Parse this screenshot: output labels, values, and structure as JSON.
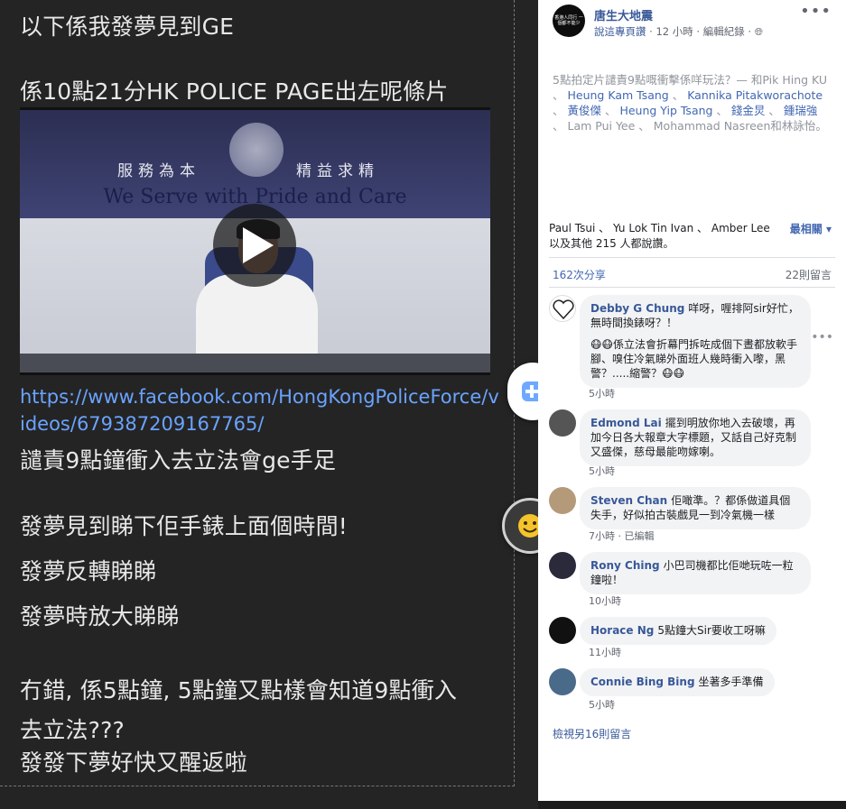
{
  "post_image": {
    "lines": [
      "以下係我發夢見到GE",
      "係10點21分HK POLICE PAGE出左呢條片",
      "譴責9點鐘衝入去立法會ge手足",
      "發夢見到睇下佢手錶上面個時間!",
      "發夢反轉睇睇",
      "發夢時放大睇睇",
      "冇錯, 係5點鐘, 5點鐘又點樣會知道9點衝入",
      "去立法???",
      "發發下夢好快又醒返啦"
    ],
    "link_line1": "https://www.facebook.com/HongKongPoliceForce/v",
    "link_line2": "ideos/679387209167765/",
    "video": {
      "motto_left": "服務為本",
      "motto_right": "精益求精",
      "slogan": "We Serve with Pride and Care"
    }
  },
  "page": {
    "avatar_text": "香港人同行 一個都不能少",
    "name": "唐生大地震",
    "meta_prefix": "說這專頁讚",
    "meta_time": "12 小時",
    "meta_edit": "編輯紀錄",
    "more": "•••"
  },
  "caption": {
    "text": "5點拍定片譴責9點嘅衝擊係咩玩法？— 和Pik Hing KU 、",
    "tags": [
      "Heung Kam Tsang",
      "Kannika Pitakworachote",
      "黃俊傑",
      "Heung Yip Tsang"
    ],
    "tags2": [
      "錢金炅",
      "鍾瑞強"
    ],
    "gray_tags": [
      "Lam Pui Yee",
      "Mohammad Nasreen"
    ],
    "tail": "和林詠怡。"
  },
  "reactions": {
    "names": "Paul Tsui 、 Yu Lok Tin Ivan 、 Amber Lee",
    "others": "以及其他 215 人都說讚。",
    "sort": "最相關"
  },
  "stats": {
    "shares": "162次分享",
    "comments": "22則留言"
  },
  "comments": [
    {
      "author": "Debby G Chung",
      "text": "咩呀，喱排阿sir好忙，無時間換錶呀？！",
      "text2": "😷😷係立法會折幕門拆咗成個下晝都放軟手腳、嗅住冷氣睇外面班人幾時衝入嚟，黑警？.....縮警？😷😷",
      "time": "5小時"
    },
    {
      "author": "Edmond Lai",
      "text": "擺到明放你地入去破壞，再加今日各大報章大字標題，又話自己好克制又盛傑，慈母最能吻嫁喇。",
      "time": "5小時"
    },
    {
      "author": "Steven Chan",
      "text": "佢噉準。？都係做道具個失手，好似拍古裝戲見一到冷氣機一樣",
      "time": "7小時 · 已編輯"
    },
    {
      "author": "Rony Ching",
      "text": "小巴司機都比佢哋玩咗一粒鐘啦！",
      "time": "10小時"
    },
    {
      "author": "Horace Ng",
      "text": "5點鐘大Sir要收工呀嘛",
      "time": "11小時"
    },
    {
      "author": "Connie Bing Bing",
      "text": "坐著多手準備",
      "time": "5小時"
    }
  ],
  "view_more": "檢視另16則留言",
  "colors": {
    "fb_blue": "#385898",
    "link_blue": "#4267b2",
    "bubble": "#f2f3f5"
  }
}
